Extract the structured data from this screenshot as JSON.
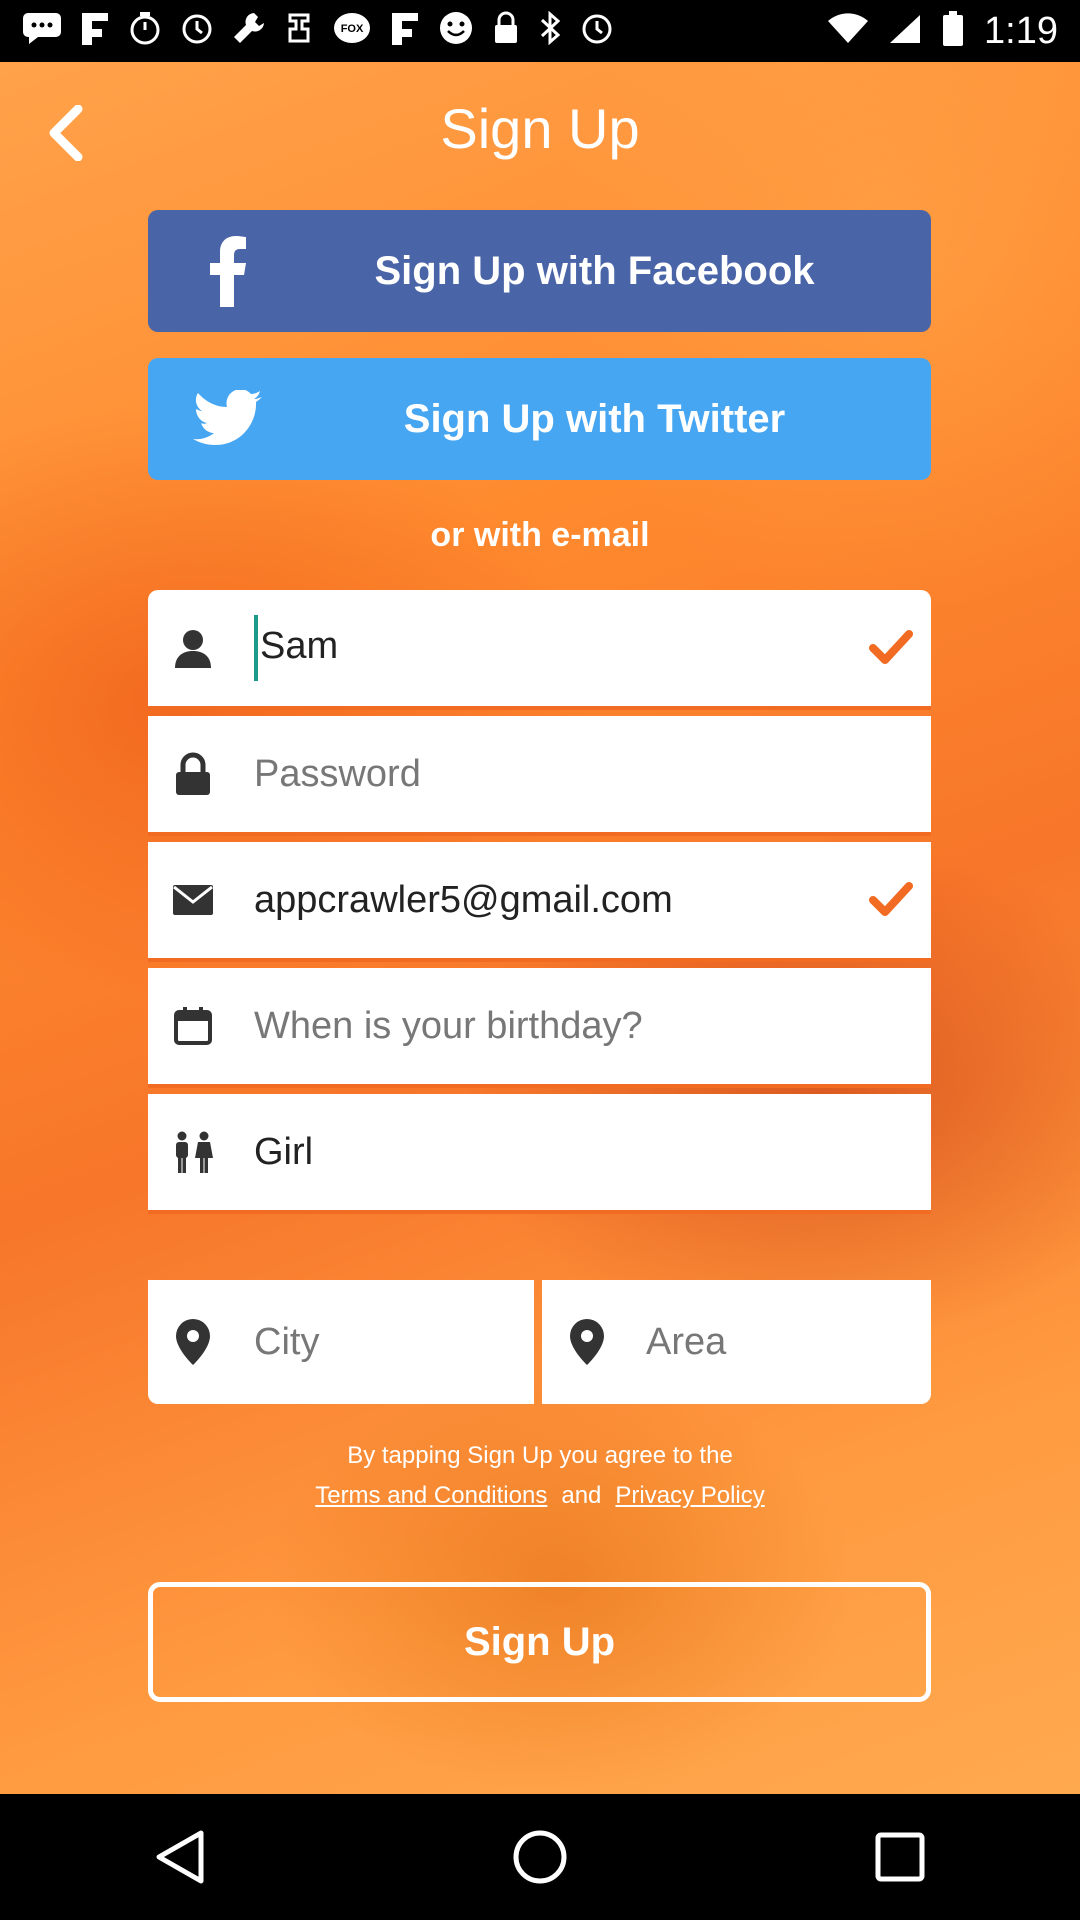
{
  "status_bar": {
    "time": "1:19",
    "left_icons": [
      "chat-icon",
      "flipboard-icon",
      "timer-icon",
      "alarm-icon",
      "wrench-icon",
      "tool-icon",
      "fox-sports-icon",
      "flipboard-icon",
      "smiley-icon",
      "lock-icon",
      "bluetooth-icon",
      "alarm-icon"
    ],
    "fox_label": "FOX"
  },
  "header": {
    "title": "Sign Up"
  },
  "social": {
    "facebook_label": "Sign Up with Facebook",
    "twitter_label": "Sign Up with Twitter",
    "facebook_color": "#4a64a8",
    "twitter_color": "#47a6f2"
  },
  "divider_label": "or with e-mail",
  "form": {
    "name_value": "Sam",
    "password_placeholder": "Password",
    "email_value": "appcrawler5@gmail.com",
    "birthday_placeholder": "When is your birthday?",
    "gender_value": "Girl",
    "city_placeholder": "City",
    "area_placeholder": "Area"
  },
  "terms": {
    "line1": "By tapping Sign Up you agree to the",
    "terms_link": "Terms and Conditions",
    "and": "and",
    "privacy_link": "Privacy Policy"
  },
  "signup_button_label": "Sign Up",
  "colors": {
    "accent": "#f26b22",
    "check": "#f26b22",
    "cursor": "#1b9c8a"
  }
}
